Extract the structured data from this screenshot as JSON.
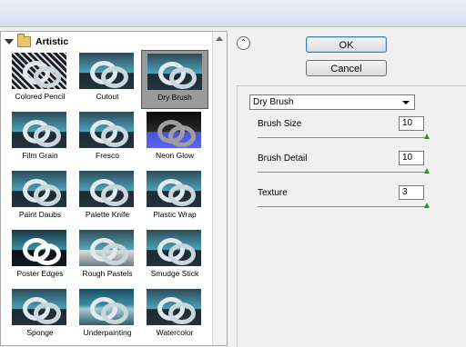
{
  "category": {
    "name": "Artistic"
  },
  "filters": [
    {
      "label": "Colored Pencil",
      "theme": "t-pencil"
    },
    {
      "label": "Cutout",
      "theme": ""
    },
    {
      "label": "Dry Brush",
      "theme": "",
      "selected": true
    },
    {
      "label": "Film Grain",
      "theme": ""
    },
    {
      "label": "Fresco",
      "theme": ""
    },
    {
      "label": "Neon Glow",
      "theme": "t-neon"
    },
    {
      "label": "Paint Daubs",
      "theme": ""
    },
    {
      "label": "Palette Knife",
      "theme": ""
    },
    {
      "label": "Plastic Wrap",
      "theme": ""
    },
    {
      "label": "Poster Edges",
      "theme": "t-poster"
    },
    {
      "label": "Rough Pastels",
      "theme": "t-pastel"
    },
    {
      "label": "Smudge Stick",
      "theme": ""
    },
    {
      "label": "Sponge",
      "theme": ""
    },
    {
      "label": "Underpainting",
      "theme": "t-under"
    },
    {
      "label": "Watercolor",
      "theme": ""
    }
  ],
  "buttons": {
    "ok": "OK",
    "cancel": "Cancel"
  },
  "filter_select": {
    "value": "Dry Brush"
  },
  "params": [
    {
      "name": "Brush Size",
      "value": "10",
      "level": 1.0
    },
    {
      "name": "Brush Detail",
      "value": "10",
      "level": 1.0
    },
    {
      "name": "Texture",
      "value": "3",
      "level": 1.0
    }
  ],
  "icons": {
    "collapse": "triangle-down-icon",
    "folder": "folder-icon",
    "toggle": "chevron-up-icon"
  }
}
